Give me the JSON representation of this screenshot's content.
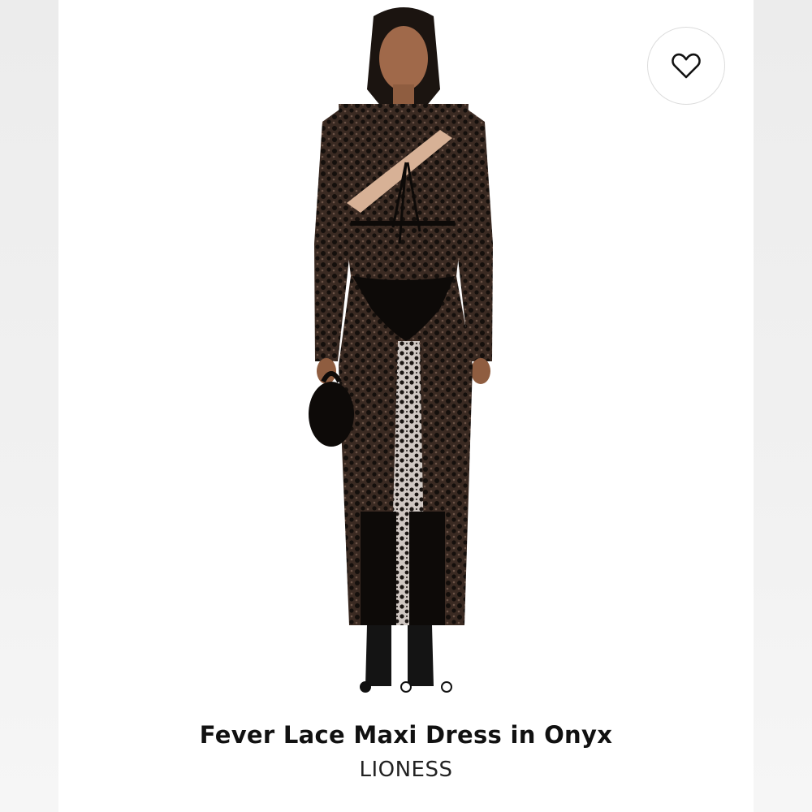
{
  "product": {
    "title": "Fever Lace Maxi Dress in Onyx",
    "brand": "LIONESS"
  },
  "wishlist": {
    "icon": "heart-outline-icon"
  },
  "carousel": {
    "total_images": 3,
    "active_index": 0
  },
  "colors": {
    "background": "#ffffff",
    "text": "#111111",
    "dress": "#1a1512"
  }
}
